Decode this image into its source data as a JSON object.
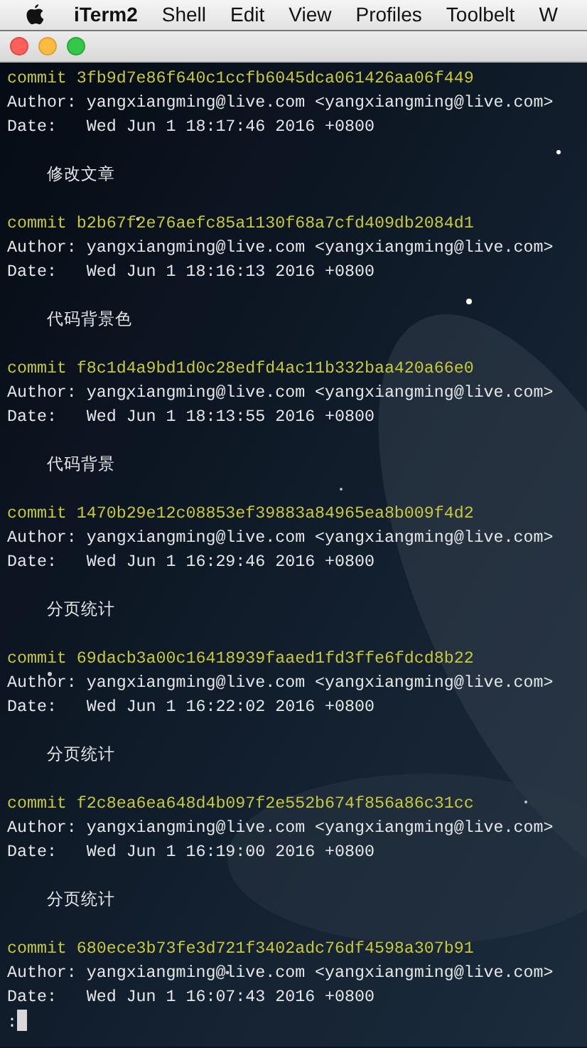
{
  "menu_bar": {
    "app_name": "iTerm2",
    "items": [
      "Shell",
      "Edit",
      "View",
      "Profiles",
      "Toolbelt",
      "W"
    ]
  },
  "window": {
    "buttons": [
      {
        "kind": "close"
      },
      {
        "kind": "minimize"
      },
      {
        "kind": "zoom"
      }
    ]
  },
  "terminal": {
    "commits": [
      {
        "commit": "commit 3fb9d7e86f640c1ccfb6045dca061426aa06f449",
        "author": "Author: yangxiangming@live.com <yangxiangming@live.com>",
        "date": "Date:   Wed Jun 1 18:17:46 2016 +0800",
        "message": "    修改文章"
      },
      {
        "commit": "commit b2b67f2e76aefc85a1130f68a7cfd409db2084d1",
        "author": "Author: yangxiangming@live.com <yangxiangming@live.com>",
        "date": "Date:   Wed Jun 1 18:16:13 2016 +0800",
        "message": "    代码背景色"
      },
      {
        "commit": "commit f8c1d4a9bd1d0c28edfd4ac11b332baa420a66e0",
        "author": "Author: yangxiangming@live.com <yangxiangming@live.com>",
        "date": "Date:   Wed Jun 1 18:13:55 2016 +0800",
        "message": "    代码背景"
      },
      {
        "commit": "commit 1470b29e12c08853ef39883a84965ea8b009f4d2",
        "author": "Author: yangxiangming@live.com <yangxiangming@live.com>",
        "date": "Date:   Wed Jun 1 16:29:46 2016 +0800",
        "message": "    分页统计"
      },
      {
        "commit": "commit 69dacb3a00c16418939faaed1fd3ffe6fdcd8b22",
        "author": "Author: yangxiangming@live.com <yangxiangming@live.com>",
        "date": "Date:   Wed Jun 1 16:22:02 2016 +0800",
        "message": "    分页统计"
      },
      {
        "commit": "commit f2c8ea6ea648d4b097f2e552b674f856a86c31cc",
        "author": "Author: yangxiangming@live.com <yangxiangming@live.com>",
        "date": "Date:   Wed Jun 1 16:19:00 2016 +0800",
        "message": "    分页统计"
      },
      {
        "commit": "commit 680ece3b73fe3d721f3402adc76df4598a307b91",
        "author": "Author: yangxiangming@live.com <yangxiangming@live.com>",
        "date": "Date:   Wed Jun 1 16:07:43 2016 +0800"
      }
    ],
    "prompt": ":"
  }
}
